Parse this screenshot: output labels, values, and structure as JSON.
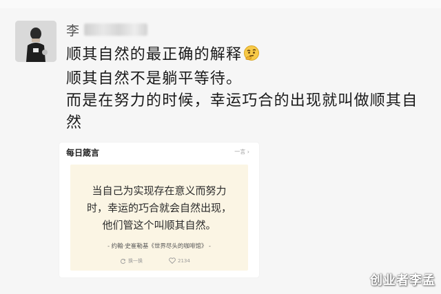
{
  "sender": {
    "name_visible": "李"
  },
  "message": {
    "lines": [
      "顺其自然的最正确的解释",
      "顺其自然不是躺平等待。",
      "而是在努力的时候，幸运巧合的出现就叫做顺其自",
      "然"
    ],
    "emoji": "thinking-face-emoji"
  },
  "card": {
    "title": "每日箴言",
    "link_label": "一言",
    "quote_lines": [
      "当自己为实现存在意义而努力",
      "时，幸运的巧合就会自然出现，",
      "他们管这个叫顺其自然。"
    ],
    "source": "- 约翰·史崔勒基《世界尽头的咖啡馆》 -",
    "refresh_label": "换一换",
    "like_count": "2134"
  },
  "watermark": "创业者李孟",
  "colors": {
    "background": "#f6f6f6",
    "card_background": "#ffffff",
    "quote_background": "#fbf5e4",
    "text": "#1a1a1a"
  }
}
